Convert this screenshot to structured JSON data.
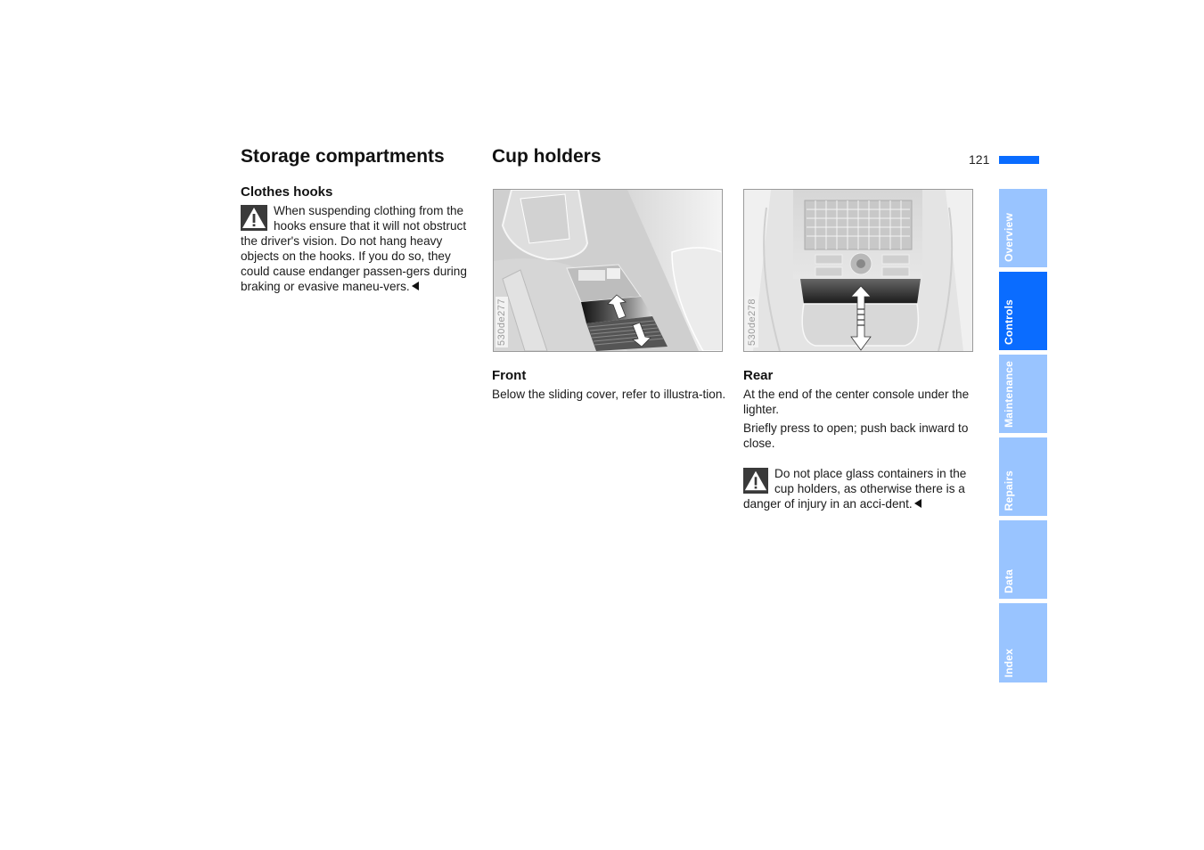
{
  "page": {
    "number": "121",
    "colors": {
      "accent": "#0a6cff",
      "tab_inactive": "#99c4ff",
      "tab_text": "#ffffff"
    }
  },
  "left": {
    "title": "Storage compartments",
    "section": {
      "heading": "Clothes hooks",
      "warning": {
        "icon": "warning-triangle-icon",
        "text": "When suspending clothing from the hooks ensure that it will not obstruct the driver's vision. Do not hang heavy objects on the hooks. If you do so, they could cause endanger passen-gers during braking or evasive maneu-vers.",
        "end_icon": "end-triangle-icon"
      }
    }
  },
  "middle": {
    "title": "Cup holders",
    "figure": {
      "code": "530de277",
      "description": "Front cup holder sliding cover with double arrow"
    },
    "heading": "Front",
    "paragraphs": [
      "Below the sliding cover, refer to illustra-tion."
    ]
  },
  "right": {
    "figure": {
      "code": "530de278",
      "description": "Rear center console cup holder with double arrow"
    },
    "heading": "Rear",
    "paragraphs": [
      "At the end of the center console under the lighter.",
      "Briefly press to open; push back inward to close."
    ],
    "warning": {
      "icon": "warning-triangle-icon",
      "text": "Do not place glass containers in the cup holders, as otherwise there is a danger of injury in an acci-dent.",
      "end_icon": "end-triangle-icon"
    }
  },
  "tabs": [
    {
      "label": "Overview",
      "active": false
    },
    {
      "label": "Controls",
      "active": true
    },
    {
      "label": "Maintenance",
      "active": false
    },
    {
      "label": "Repairs",
      "active": false
    },
    {
      "label": "Data",
      "active": false
    },
    {
      "label": "Index",
      "active": false
    }
  ]
}
